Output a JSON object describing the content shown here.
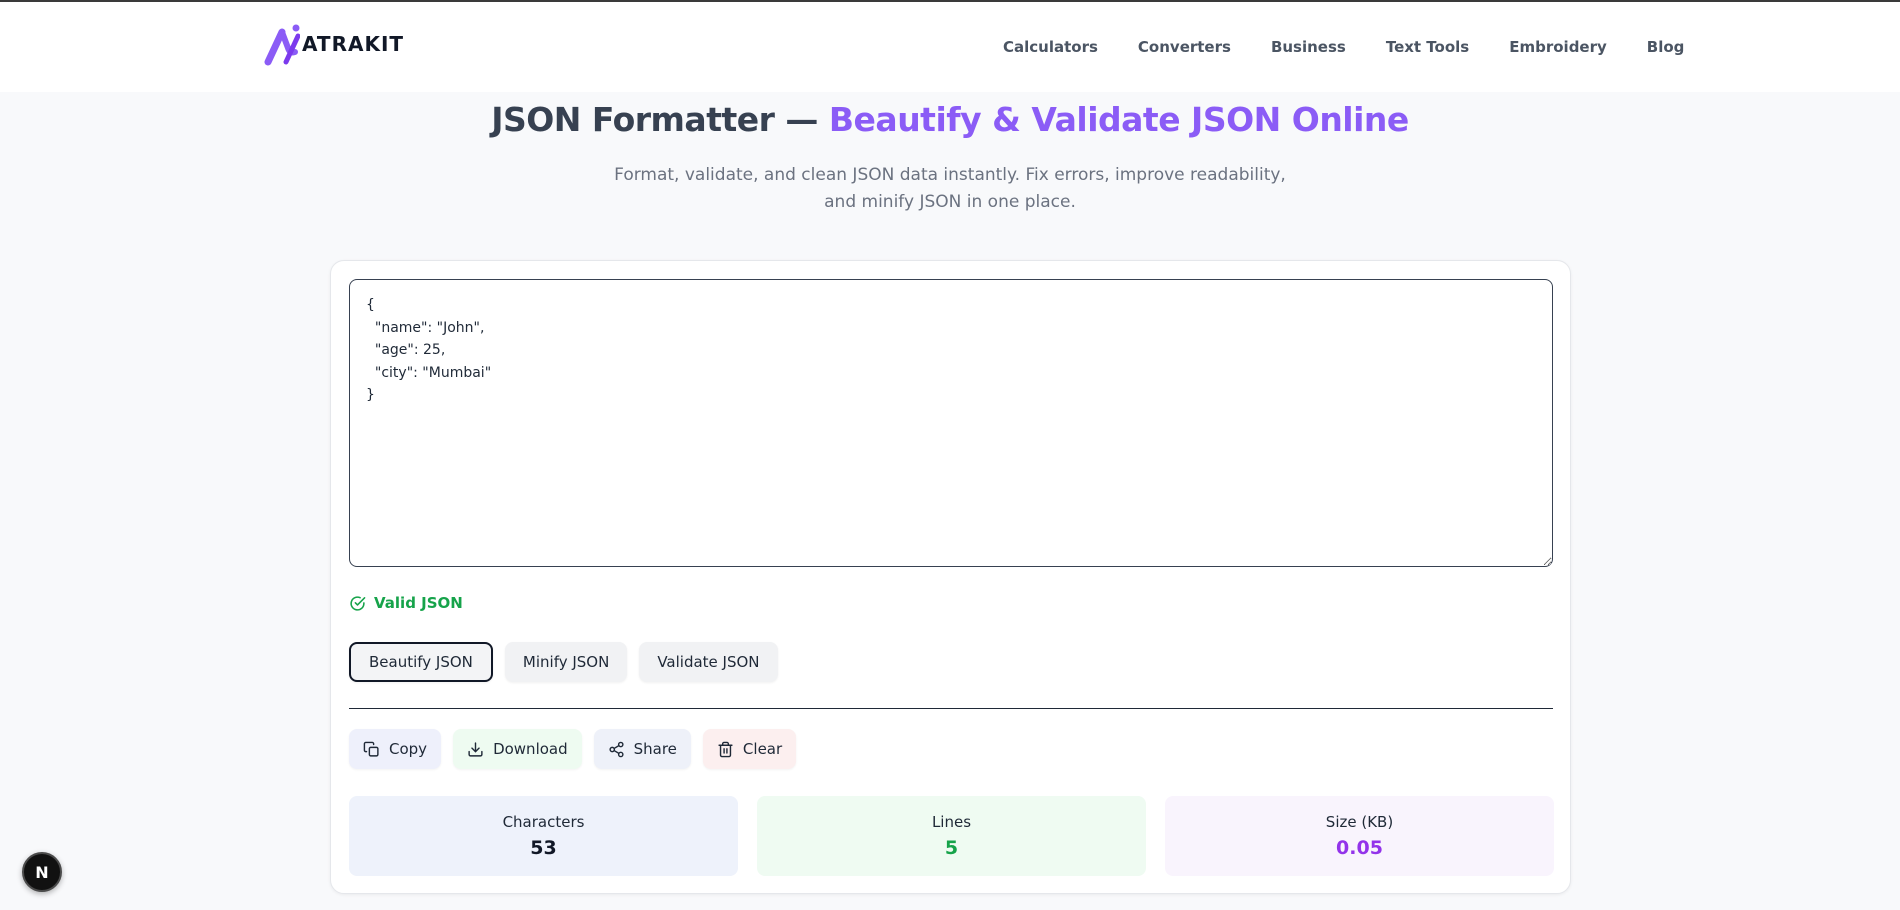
{
  "brand": {
    "logo_text": "ATRAKIT"
  },
  "nav": {
    "items": [
      {
        "label": "Calculators"
      },
      {
        "label": "Converters"
      },
      {
        "label": "Business"
      },
      {
        "label": "Text Tools"
      },
      {
        "label": "Embroidery"
      },
      {
        "label": "Blog"
      }
    ]
  },
  "page": {
    "title_main": "JSON Formatter — ",
    "title_accent": "Beautify & Validate JSON Online",
    "subtitle_line1": "Format, validate, and clean JSON data instantly. Fix errors, improve readability,",
    "subtitle_line2": "and minify JSON in one place."
  },
  "editor": {
    "value": "{\n  \"name\": \"John\",\n  \"age\": 25,\n  \"city\": \"Mumbai\"\n}"
  },
  "status": {
    "text": "Valid JSON",
    "color": "#16a34a"
  },
  "actions": {
    "beautify": "Beautify JSON",
    "minify": "Minify JSON",
    "validate": "Validate JSON"
  },
  "tools": {
    "copy": "Copy",
    "download": "Download",
    "share": "Share",
    "clear": "Clear"
  },
  "stats": {
    "characters": {
      "label": "Characters",
      "value": "53",
      "color": "#111827",
      "bg": "#eef2fb"
    },
    "lines": {
      "label": "Lines",
      "value": "5",
      "color": "#16a34a",
      "bg": "#effbf2"
    },
    "size": {
      "label": "Size (KB)",
      "value": "0.05",
      "color": "#9333ea",
      "bg": "#f9f4fd"
    }
  },
  "fab": {
    "letter": "N"
  },
  "colors": {
    "accent": "#8b5cf6"
  }
}
